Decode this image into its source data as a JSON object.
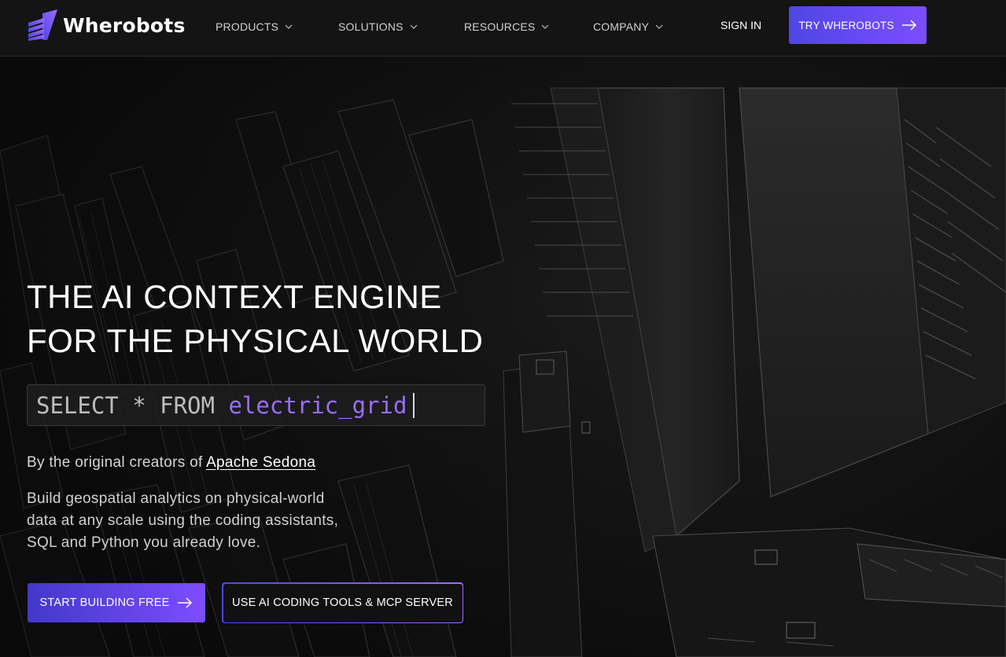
{
  "brand": {
    "name": "Wherobots",
    "accent": "#6b4dff",
    "accent_secondary": "#4f46e5"
  },
  "nav": {
    "items": [
      {
        "label": "PRODUCTS",
        "icon": "chevron-down-icon"
      },
      {
        "label": "SOLUTIONS",
        "icon": "chevron-down-icon"
      },
      {
        "label": "RESOURCES",
        "icon": "chevron-down-icon"
      },
      {
        "label": "COMPANY",
        "icon": "chevron-down-icon"
      }
    ],
    "sign_in": "SIGN IN",
    "cta": {
      "label": "TRY WHEROBOTS",
      "icon": "arrow-right-icon"
    }
  },
  "hero": {
    "title_lines": [
      "THE AI CONTEXT ENGINE",
      "FOR THE PHYSICAL WORLD"
    ],
    "query": {
      "keywords": "SELECT * FROM ",
      "table": "electric_grid"
    },
    "creators_prefix": "By the original creators of ",
    "creators_link": "Apache Sedona",
    "description_lines": [
      "Build geospatial analytics on physical-world",
      "data at any scale using the coding assistants,",
      "SQL and Python you already love."
    ],
    "primary_button": {
      "label": "START BUILDING FREE",
      "icon": "arrow-right-icon"
    },
    "secondary_button": {
      "label": "USE AI CODING TOOLS & MCP SERVER"
    }
  }
}
